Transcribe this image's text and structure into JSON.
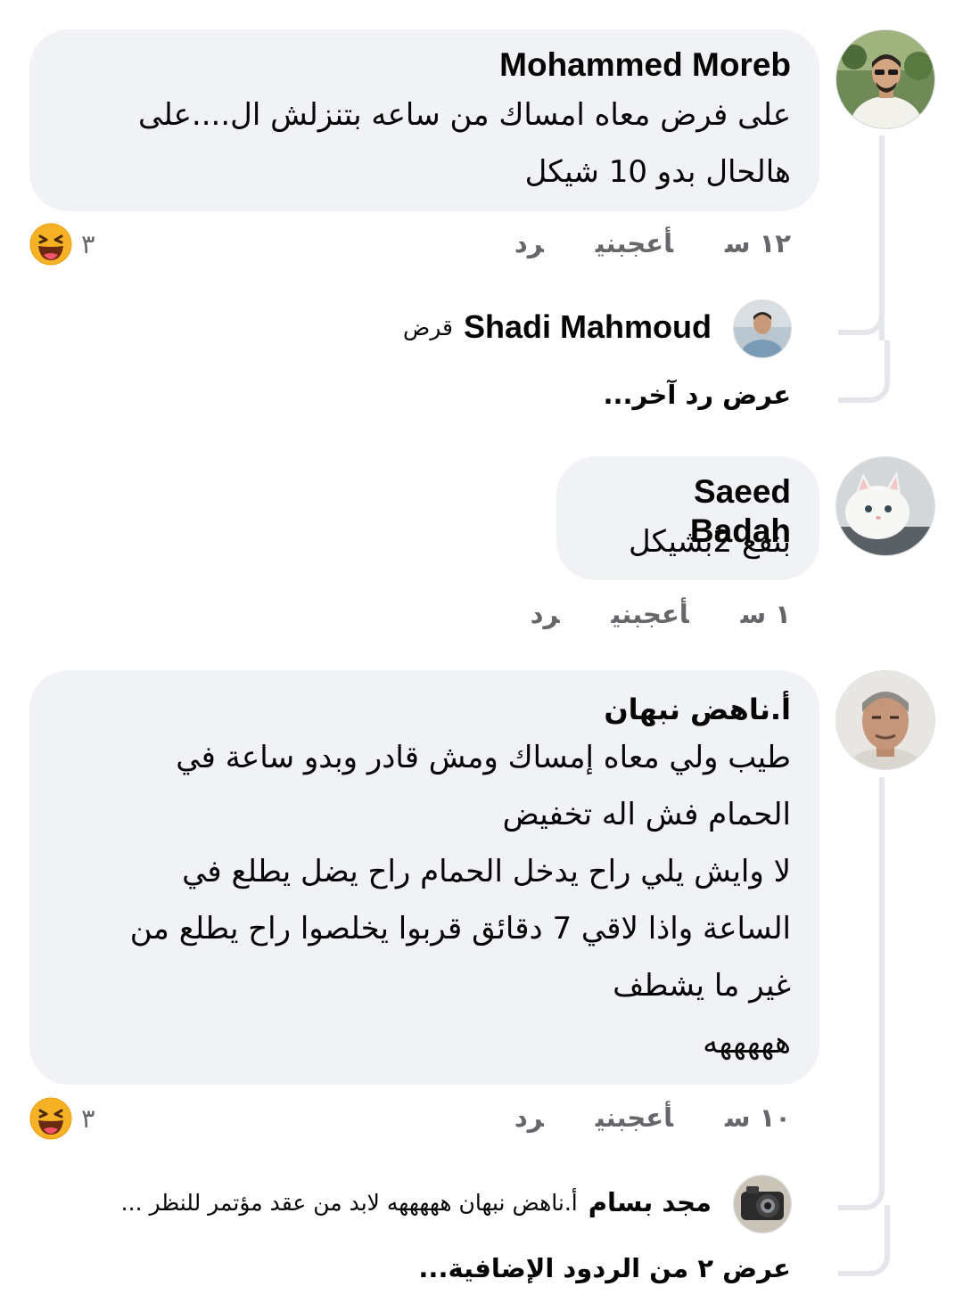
{
  "comments": [
    {
      "author": "Mohammed Moreb",
      "text": "على فرض معاه امساك من ساعه بتنزلش ال....على\nهالحال بدو 10 شيكل",
      "time": "١٢ س",
      "like_label": "أعجبني",
      "reply_label": "رد",
      "reaction_count": "٣",
      "reaction_icon": "haha-emoji-icon",
      "replies": [
        {
          "author": "Shadi Mahmoud",
          "text": "قرض"
        }
      ],
      "more_replies_label": "عرض رد آخر..."
    },
    {
      "author": "Saeed Badah",
      "text": "بنفع 2بشيكل",
      "time": "١ س",
      "like_label": "أعجبني",
      "reply_label": "رد"
    },
    {
      "author": "أ.ناهض نبهان",
      "text": "طيب ولي معاه إمساك ومش قادر وبدو ساعة في\nالحمام فش اله تخفيض\nلا وايش يلي راح يدخل الحمام راح يضل يطلع في\nالساعة واذا لاقي 7 دقائق قربوا يخلصوا راح يطلع من\nغير ما يشطف\nهههههه",
      "time": "١٠ س",
      "like_label": "أعجبني",
      "reply_label": "رد",
      "reaction_count": "٣",
      "reaction_icon": "haha-emoji-icon",
      "replies": [
        {
          "author": "مجد بسام",
          "text": "أ.ناهض نبهان هههههه لابد من عقد مؤتمر للنظر ..."
        }
      ],
      "more_replies_label": "عرض ٢ من الردود الإضافية..."
    }
  ],
  "colors": {
    "bubble": "#f0f2f5",
    "secondary_text": "#65676b",
    "thread_line": "#e4e6eb",
    "emoji_face": "#f7b125",
    "emoji_mouth": "#6a2b10"
  }
}
